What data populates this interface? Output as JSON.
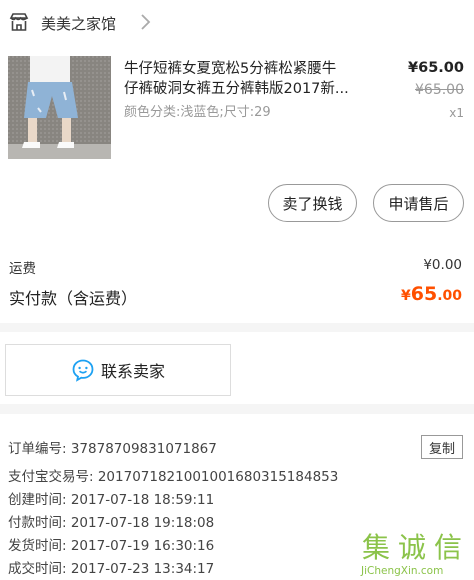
{
  "store": {
    "name": "美美之家馆"
  },
  "product": {
    "title_line1": "牛仔短裤女夏宽松5分裤松紧腰牛",
    "title_line2": "仔裤破洞女裤五分裤韩版2017新...",
    "sku": "颜色分类:浅蓝色;尺寸:29",
    "price": "¥65.00",
    "original_price": "¥65.00",
    "quantity": "x1"
  },
  "actions": {
    "refund_label": "卖了换钱",
    "after_sale_label": "申请售后"
  },
  "summary": {
    "shipping_label": "运费",
    "shipping_value": "¥0.00",
    "paid_label": "实付款（含运费）",
    "paid_currency": "¥",
    "paid_integer": "65",
    "paid_decimal": ".00",
    "accent_color": "#ff5000"
  },
  "contact": {
    "label": "联系卖家",
    "icon": "chat-bubble-smile-icon"
  },
  "order_info": {
    "order_no": "订单编号:  37878709831071867",
    "alipay_no": "支付宝交易号:  2017071821001001680315184853",
    "created": "创建时间:  2017-07-18 18:59:11",
    "paid": "付款时间:  2017-07-18 19:18:08",
    "shipped": "发货时间:  2017-07-19 16:30:16",
    "completed": "成交时间:  2017-07-23 13:34:17",
    "copy_label": "复制"
  },
  "watermark": {
    "chars": [
      "集",
      "诚",
      "信"
    ],
    "url": "JiChengXin.com"
  }
}
